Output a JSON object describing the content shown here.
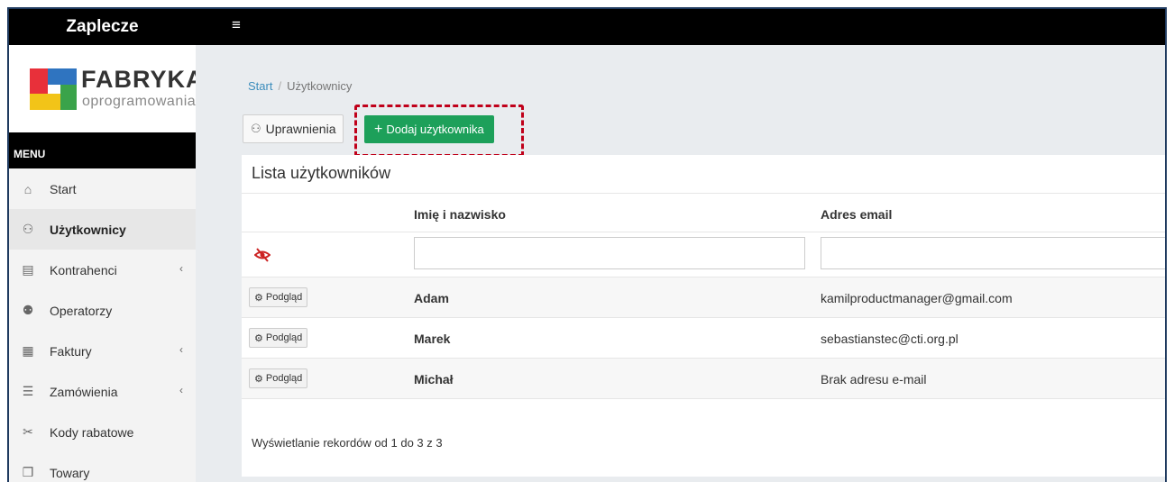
{
  "topbar": {
    "brand": "Zaplecze",
    "menu_toggle_icon": "≡"
  },
  "logo": {
    "line1": "FABRYKA",
    "line2": "oprogramowania",
    "colors": [
      "#e8303a",
      "#2f74c0",
      "#f2c418",
      "#3aa34a"
    ]
  },
  "sidebar": {
    "header": "MENU",
    "items": [
      {
        "label": "Start",
        "icon": "home-icon",
        "glyph": "⌂",
        "expandable": false,
        "active": false
      },
      {
        "label": "Użytkownicy",
        "icon": "users-icon",
        "glyph": "⚇",
        "expandable": false,
        "active": true
      },
      {
        "label": "Kontrahenci",
        "icon": "address-card-icon",
        "glyph": "▤",
        "expandable": true,
        "active": false
      },
      {
        "label": "Operatorzy",
        "icon": "operators-icon",
        "glyph": "⚉",
        "expandable": false,
        "active": false
      },
      {
        "label": "Faktury",
        "icon": "invoice-icon",
        "glyph": "▦",
        "expandable": true,
        "active": false
      },
      {
        "label": "Zamówienia",
        "icon": "list-icon",
        "glyph": "☰",
        "expandable": true,
        "active": false
      },
      {
        "label": "Kody rabatowe",
        "icon": "scissors-icon",
        "glyph": "✂",
        "expandable": false,
        "active": false
      },
      {
        "label": "Towary",
        "icon": "boxes-icon",
        "glyph": "❒",
        "expandable": false,
        "active": false
      }
    ]
  },
  "breadcrumb": {
    "home": "Start",
    "separator": "/",
    "current": "Użytkownicy"
  },
  "toolbar": {
    "permissions_label": "Uprawnienia",
    "add_user_label": "Dodaj użytkownika",
    "add_color": "#1da05a",
    "highlight_color": "#c0001a"
  },
  "card": {
    "title": "Lista użytkowników",
    "columns": {
      "name": "Imię i nazwisko",
      "email": "Adres email"
    },
    "filter": {
      "name_value": "",
      "email_value": ""
    },
    "view_label": "Podgląd",
    "rows": [
      {
        "name": "Adam",
        "email": "kamilproductmanager@gmail.com"
      },
      {
        "name": "Marek",
        "email": "sebastianstec@cti.org.pl"
      },
      {
        "name": "Michał",
        "email": "Brak adresu e-mail"
      }
    ],
    "info": "Wyświetlanie rekordów od 1 do 3 z 3"
  }
}
